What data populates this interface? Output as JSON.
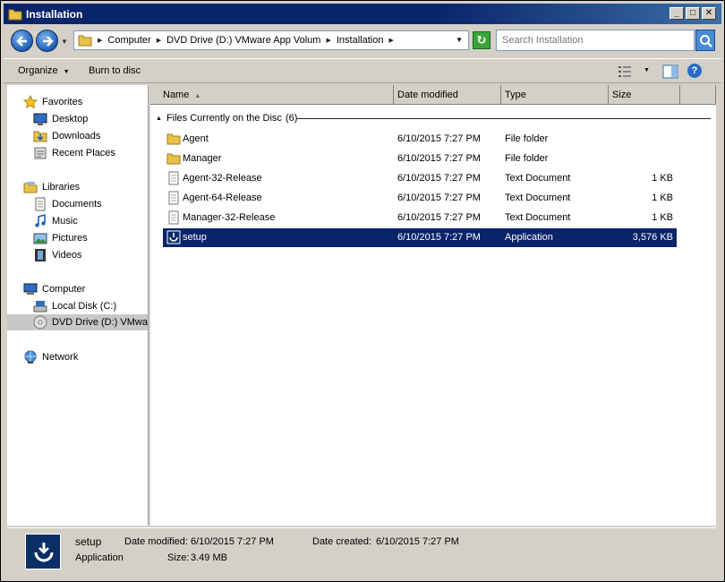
{
  "window": {
    "title": "Installation",
    "controls": {
      "minimize": "_",
      "maximize": "□",
      "close": "✕"
    }
  },
  "address": {
    "breadcrumbs": [
      "Computer",
      "DVD Drive (D:) VMware App Volum",
      "Installation"
    ],
    "search_placeholder": "Search Installation"
  },
  "toolbar": {
    "organize": "Organize",
    "burn": "Burn to disc",
    "help": "?"
  },
  "nav": {
    "favorites": "Favorites",
    "desktop": "Desktop",
    "downloads": "Downloads",
    "recent": "Recent Places",
    "libraries": "Libraries",
    "documents": "Documents",
    "music": "Music",
    "pictures": "Pictures",
    "videos": "Videos",
    "computer": "Computer",
    "local_disk": "Local Disk (C:)",
    "dvd_drive": "DVD Drive (D:) VMware",
    "network": "Network"
  },
  "columns": {
    "name": "Name",
    "date": "Date modified",
    "type": "Type",
    "size": "Size"
  },
  "group": {
    "label": "Files Currently on the Disc",
    "count": "(6)"
  },
  "files": [
    {
      "name": "Agent",
      "date": "6/10/2015 7:27 PM",
      "type": "File folder",
      "size": "",
      "icon": "folder-icon"
    },
    {
      "name": "Manager",
      "date": "6/10/2015 7:27 PM",
      "type": "File folder",
      "size": "",
      "icon": "folder-icon"
    },
    {
      "name": "Agent-32-Release",
      "date": "6/10/2015 7:27 PM",
      "type": "Text Document",
      "size": "1 KB",
      "icon": "text-document-icon"
    },
    {
      "name": "Agent-64-Release",
      "date": "6/10/2015 7:27 PM",
      "type": "Text Document",
      "size": "1 KB",
      "icon": "text-document-icon"
    },
    {
      "name": "Manager-32-Release",
      "date": "6/10/2015 7:27 PM",
      "type": "Text Document",
      "size": "1 KB",
      "icon": "text-document-icon"
    },
    {
      "name": "setup",
      "date": "6/10/2015 7:27 PM",
      "type": "Application",
      "size": "3,576 KB",
      "icon": "application-icon"
    }
  ],
  "details": {
    "name": "setup",
    "type": "Application",
    "modified_label": "Date modified:",
    "modified_value": "6/10/2015 7:27 PM",
    "created_label": "Date created:",
    "created_value": "6/10/2015 7:27 PM",
    "size_label": "Size:",
    "size_value": "3.49 MB"
  },
  "colors": {
    "selection": "#0a246a",
    "titlebar": "#0a246a",
    "chrome": "#d4d0c8"
  }
}
